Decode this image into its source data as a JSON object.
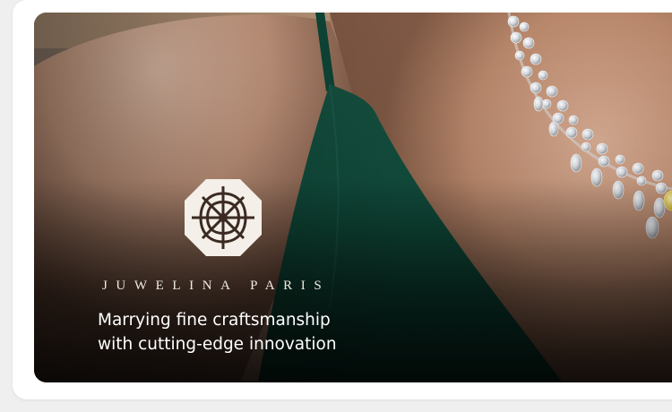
{
  "hero": {
    "brand_name": "JUWELINA PARIS",
    "tagline_line1": "Marrying fine craftsmanship",
    "tagline_line2": "with cutting-edge innovation",
    "logo_icon": "octagonal-lattice-emblem",
    "image_subject": "diamond-necklace-on-model"
  },
  "colors": {
    "page_background": "#efefef",
    "card_background": "#ffffff",
    "dress_green": "#0f4a3a",
    "skin_tone": "#c99a80",
    "text_light": "#f1ebe4"
  }
}
